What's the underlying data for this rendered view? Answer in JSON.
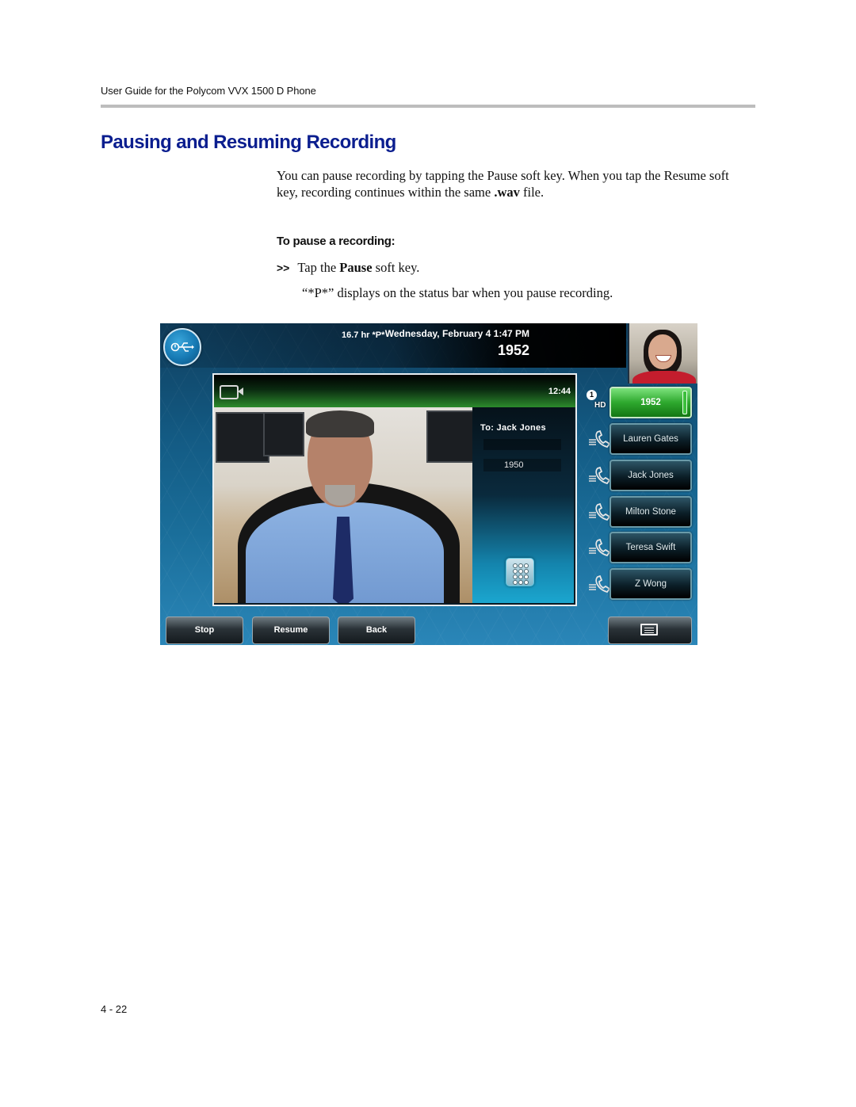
{
  "document": {
    "running_header": "User Guide for the Polycom VVX 1500 D Phone",
    "section_title": "Pausing and Resuming Recording",
    "intro": {
      "part1": "You can pause recording by tapping the Pause soft key. When you tap the Resume soft key, recording continues within the same ",
      "bold": ".wav",
      "part2": " file."
    },
    "procedure_heading": "To pause a recording:",
    "step": {
      "marker": ">>",
      "pre": "Tap the ",
      "bold": "Pause",
      "post": " soft key."
    },
    "step_result": "“*P*” displays on the status bar when you pause recording.",
    "page_number": "4 - 22"
  },
  "phone_screen": {
    "status_bar": {
      "usb_icon": "usb-recording-icon",
      "recording_status": "16.7 hr  *P*",
      "datetime": "Wednesday, February 4  1:47 PM",
      "line_number": "1952"
    },
    "call": {
      "timer": "12:44",
      "to_label": "To: Jack Jones",
      "dialed_number": "1950"
    },
    "line_indicator": {
      "badge": "1",
      "hd_label": "HD"
    },
    "line_keys": [
      {
        "label": "1952",
        "active": true
      },
      {
        "label": "Lauren Gates",
        "active": false
      },
      {
        "label": "Jack Jones",
        "active": false
      },
      {
        "label": "Milton Stone",
        "active": false
      },
      {
        "label": "Teresa Swift",
        "active": false
      },
      {
        "label": "Z Wong",
        "active": false
      }
    ],
    "soft_keys": [
      {
        "label": "Stop"
      },
      {
        "label": "Resume"
      },
      {
        "label": "Back"
      }
    ],
    "colors": {
      "active_line": "#2ea82e",
      "heading_blue": "#0b1e8f"
    }
  }
}
